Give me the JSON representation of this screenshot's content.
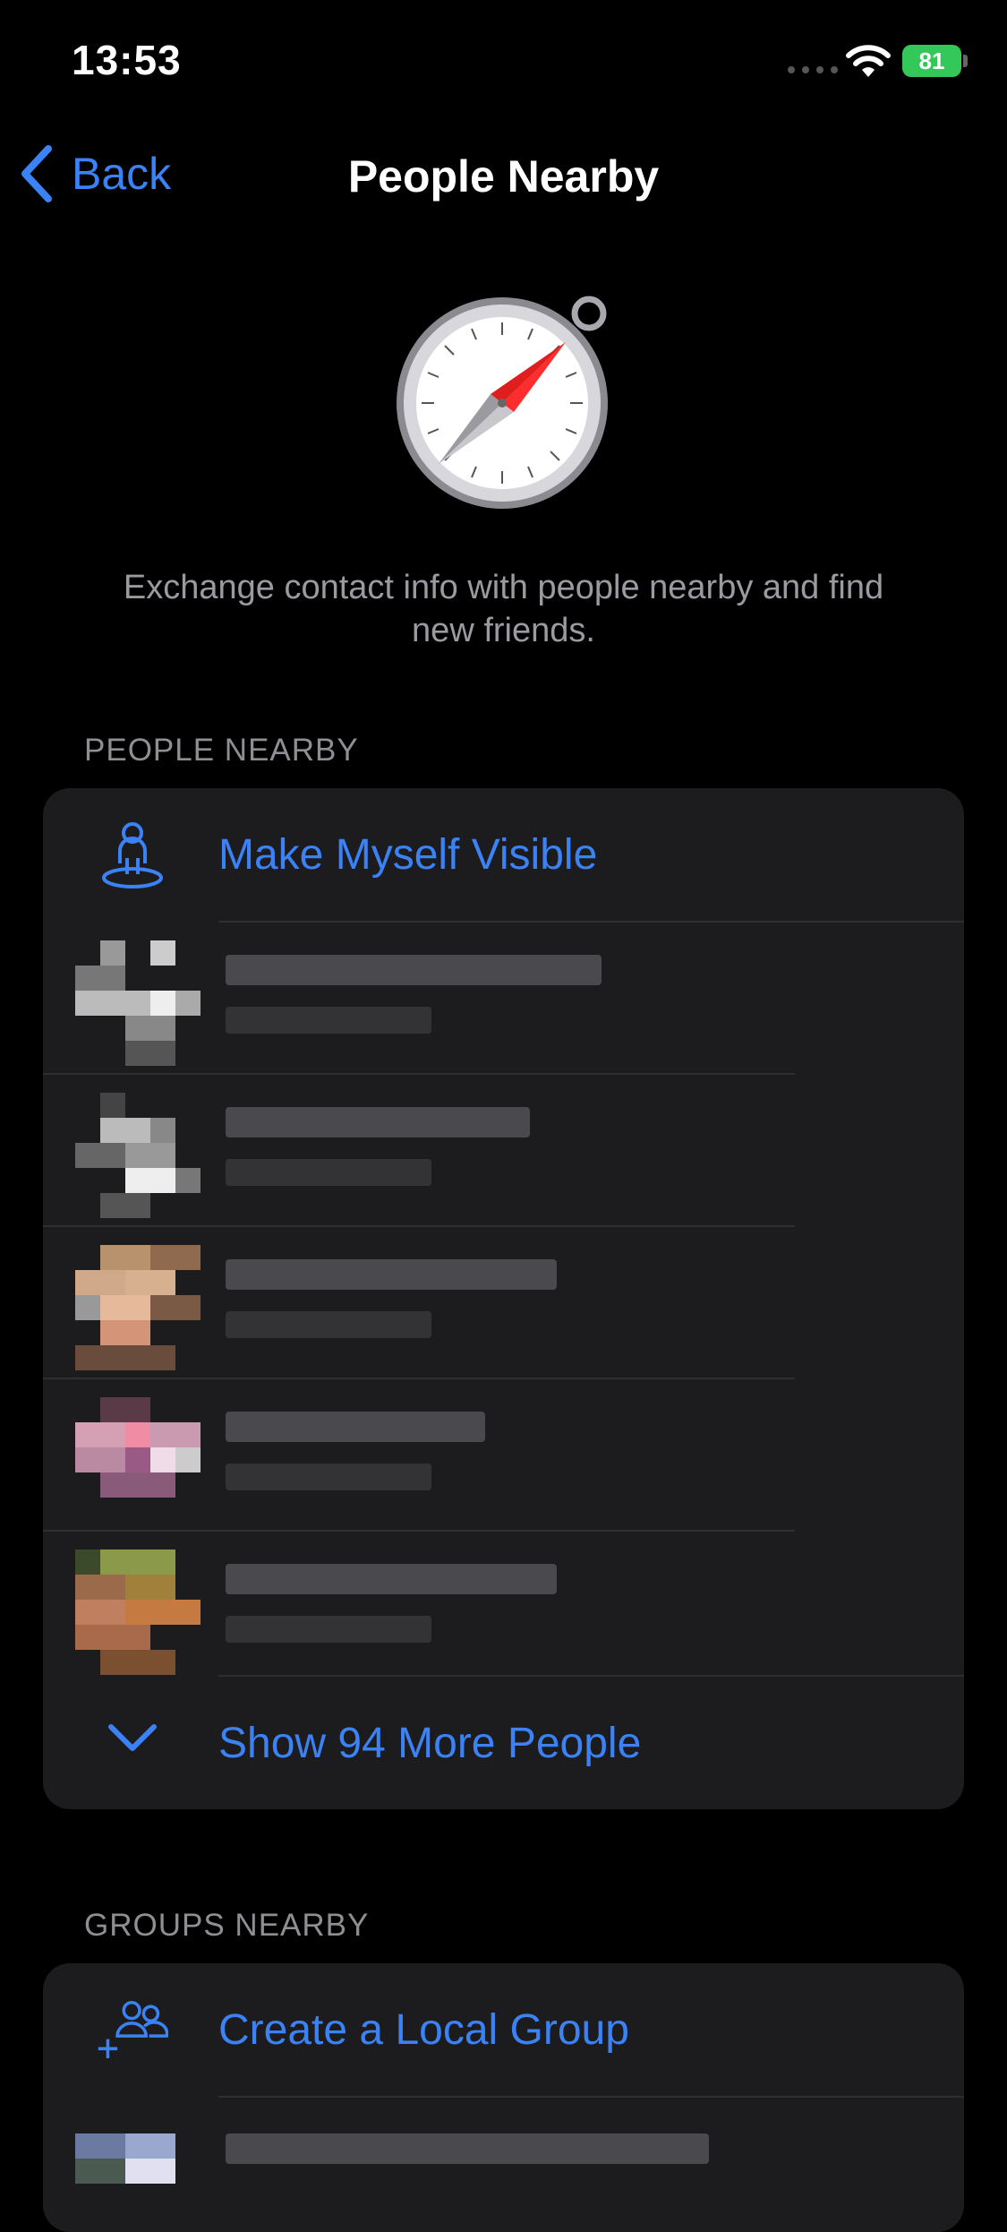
{
  "status_bar": {
    "time": "13:53",
    "battery": "81"
  },
  "nav": {
    "back_label": "Back",
    "title": "People Nearby"
  },
  "intro_text": "Exchange contact info with people nearby and find new friends.",
  "people_section": {
    "header": "PEOPLE NEARBY",
    "make_visible_label": "Make Myself Visible",
    "show_more_label": "Show 94 More People"
  },
  "groups_section": {
    "header": "GROUPS NEARBY",
    "create_group_label": "Create a Local Group"
  },
  "colors": {
    "accent": "#3b82f6",
    "background": "#000000",
    "card": "#1c1c1e",
    "secondary_text": "#8e8e93",
    "battery": "#34c759"
  },
  "icons": {
    "back": "chevron-left-icon",
    "visible": "person-on-pin-icon",
    "show_more": "chevron-down-icon",
    "create_group": "add-group-icon",
    "hero": "compass-icon"
  }
}
